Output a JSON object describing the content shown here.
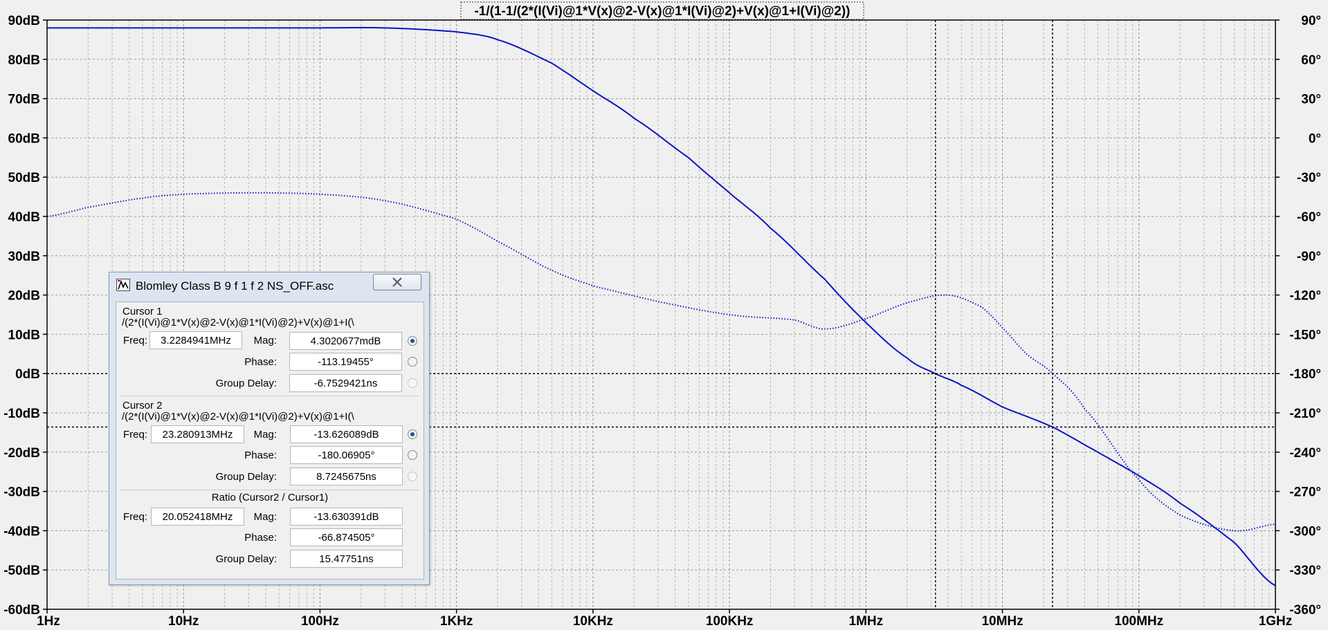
{
  "chart_data": {
    "type": "line",
    "title": "-1/(1-1/(2*(I(Vi)@1*V(x)@2-V(x)@1*I(Vi)@2)+V(x)@1+I(Vi)@2))",
    "x_scale": "log",
    "xlim": [
      1,
      1000000000
    ],
    "x_ticks": [
      "1Hz",
      "10Hz",
      "100Hz",
      "1KHz",
      "10KHz",
      "100KHz",
      "1MHz",
      "10MHz",
      "100MHz",
      "1GHz"
    ],
    "y_left_lim": [
      -60,
      90
    ],
    "y_left_ticks": [
      "90dB",
      "80dB",
      "70dB",
      "60dB",
      "50dB",
      "40dB",
      "30dB",
      "20dB",
      "10dB",
      "0dB",
      "-10dB",
      "-20dB",
      "-30dB",
      "-40dB",
      "-50dB",
      "-60dB"
    ],
    "y_right_lim": [
      -360,
      90
    ],
    "y_right_ticks": [
      "90°",
      "60°",
      "30°",
      "0°",
      "-30°",
      "-60°",
      "-90°",
      "-120°",
      "-150°",
      "-180°",
      "-210°",
      "-240°",
      "-270°",
      "-300°",
      "-330°",
      "-360°"
    ],
    "grid": true,
    "series": [
      {
        "axis": "left",
        "style": "solid",
        "color": "#0a14c8",
        "x": [
          1,
          10,
          100,
          300,
          1000,
          2000,
          5000,
          10000,
          20000,
          50000,
          100000,
          200000,
          500000,
          1000000,
          2000000,
          3228494,
          5000000,
          10000000,
          23280913,
          50000000,
          100000000,
          200000000,
          500000000,
          1000000000
        ],
        "y": [
          88,
          88,
          88,
          88,
          87,
          85,
          79,
          72,
          65,
          55,
          46,
          37,
          24,
          13,
          4,
          0,
          -3,
          -8.5,
          -13.6,
          -20,
          -26,
          -33,
          -43,
          -54
        ]
      },
      {
        "axis": "right",
        "style": "dotted",
        "color": "#0a14c8",
        "x": [
          1,
          2,
          5,
          10,
          30,
          100,
          300,
          1000,
          2000,
          5000,
          10000,
          30000,
          100000,
          300000,
          500000,
          1000000,
          2000000,
          4000000,
          7000000,
          10000000,
          15000000,
          23280913,
          40000000,
          100000000,
          200000000,
          500000000,
          1000000000
        ],
        "y": [
          -60,
          -53,
          -46,
          -43,
          -42,
          -43,
          -48,
          -62,
          -79,
          -101,
          -113,
          -125,
          -135,
          -139,
          -146,
          -138,
          -126,
          -120,
          -129,
          -145,
          -165,
          -180,
          -207,
          -261,
          -288,
          -300,
          -295
        ]
      }
    ],
    "cursors": [
      {
        "name": "Cursor 1",
        "x": 3228494,
        "y": 0
      },
      {
        "name": "Cursor 2",
        "x": 23280913,
        "y": -13.6
      }
    ]
  },
  "cursor_window": {
    "title": "Blomley Class B 9 f 1 f 2 NS_OFF.asc",
    "app_icon": "ltspice-icon",
    "close_icon": "close-icon",
    "cursor1": {
      "title": "Cursor 1",
      "expr": "/(2*(I(Vi)@1*V(x)@2-V(x)@1*I(Vi)@2)+V(x)@1+I(\\",
      "freq_label": "Freq:",
      "freq": "3.2284941MHz",
      "mag_label": "Mag:",
      "mag": "4.3020677mdB",
      "phase_label": "Phase:",
      "phase": "-113.19455°",
      "gd_label": "Group Delay:",
      "gd": "-6.7529421ns"
    },
    "cursor2": {
      "title": "Cursor 2",
      "expr": "/(2*(I(Vi)@1*V(x)@2-V(x)@1*I(Vi)@2)+V(x)@1+I(\\",
      "freq_label": "Freq:",
      "freq": "23.280913MHz",
      "mag_label": "Mag:",
      "mag": "-13.626089dB",
      "phase_label": "Phase:",
      "phase": "-180.06905°",
      "gd_label": "Group Delay:",
      "gd": "8.7245675ns"
    },
    "ratio": {
      "title": "Ratio (Cursor2 / Cursor1)",
      "freq_label": "Freq:",
      "freq": "20.052418MHz",
      "mag_label": "Mag:",
      "mag": "-13.630391dB",
      "phase_label": "Phase:",
      "phase": "-66.874505°",
      "gd_label": "Group Delay:",
      "gd": "15.47751ns"
    }
  }
}
